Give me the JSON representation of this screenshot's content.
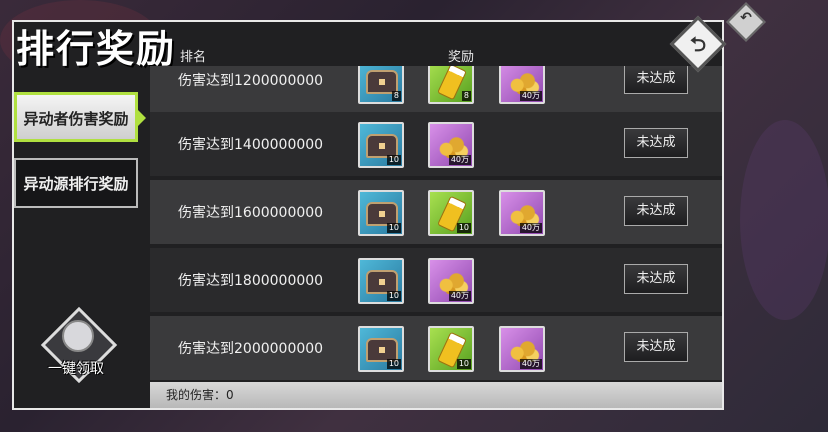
{
  "title": "排行奖励",
  "columns": {
    "rank": "排名",
    "reward": "奖励"
  },
  "sidebar": {
    "tabs": [
      {
        "label": "异动者伤害奖励",
        "active": true
      },
      {
        "label": "异动源排行奖励",
        "active": false
      }
    ]
  },
  "claim_all": {
    "label": "一键领取"
  },
  "rows": [
    {
      "label": "伤害达到1200000000",
      "status": "未达成",
      "items": [
        {
          "type": "chest",
          "color": "blue",
          "qty": "8"
        },
        {
          "type": "vial",
          "color": "green",
          "qty": "8"
        },
        {
          "type": "coins",
          "color": "purple",
          "qty": "40万"
        }
      ]
    },
    {
      "label": "伤害达到1400000000",
      "status": "未达成",
      "items": [
        {
          "type": "chest",
          "color": "blue",
          "qty": "10"
        },
        {
          "type": "coins",
          "color": "purple",
          "qty": "40万"
        }
      ]
    },
    {
      "label": "伤害达到1600000000",
      "status": "未达成",
      "items": [
        {
          "type": "chest",
          "color": "blue",
          "qty": "10"
        },
        {
          "type": "vial",
          "color": "green",
          "qty": "10"
        },
        {
          "type": "coins",
          "color": "purple",
          "qty": "40万"
        }
      ]
    },
    {
      "label": "伤害达到1800000000",
      "status": "未达成",
      "items": [
        {
          "type": "chest",
          "color": "blue",
          "qty": "10"
        },
        {
          "type": "coins",
          "color": "purple",
          "qty": "40万"
        }
      ]
    },
    {
      "label": "伤害达到2000000000",
      "status": "未达成",
      "items": [
        {
          "type": "chest",
          "color": "blue",
          "qty": "10"
        },
        {
          "type": "vial",
          "color": "green",
          "qty": "10"
        },
        {
          "type": "coins",
          "color": "purple",
          "qty": "40万"
        }
      ]
    }
  ],
  "footer": {
    "my_damage": "我的伤害：0"
  },
  "back_icon": "back-arrow-icon"
}
